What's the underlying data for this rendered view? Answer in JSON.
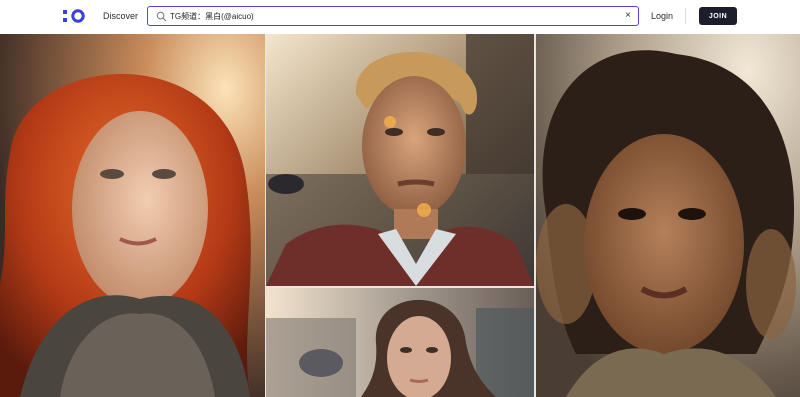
{
  "header": {
    "logo": "logo-icon",
    "nav": {
      "discover": "Discover",
      "login": "Login"
    },
    "search": {
      "value": "TG频道：黑白(@aicuo)",
      "clear_icon": "×"
    },
    "join_label": "JOIN"
  },
  "gallery": {
    "images": [
      {
        "subject": "woman-red-hair-portrait"
      },
      {
        "subject": "man-golden-hour-portrait"
      },
      {
        "subject": "woman-street-portrait"
      },
      {
        "subject": "child-curly-hair-portrait"
      }
    ]
  },
  "colors": {
    "accent": "#4f46e5",
    "join_bg": "#1c1f2b",
    "logo": "#3b3fd8"
  }
}
